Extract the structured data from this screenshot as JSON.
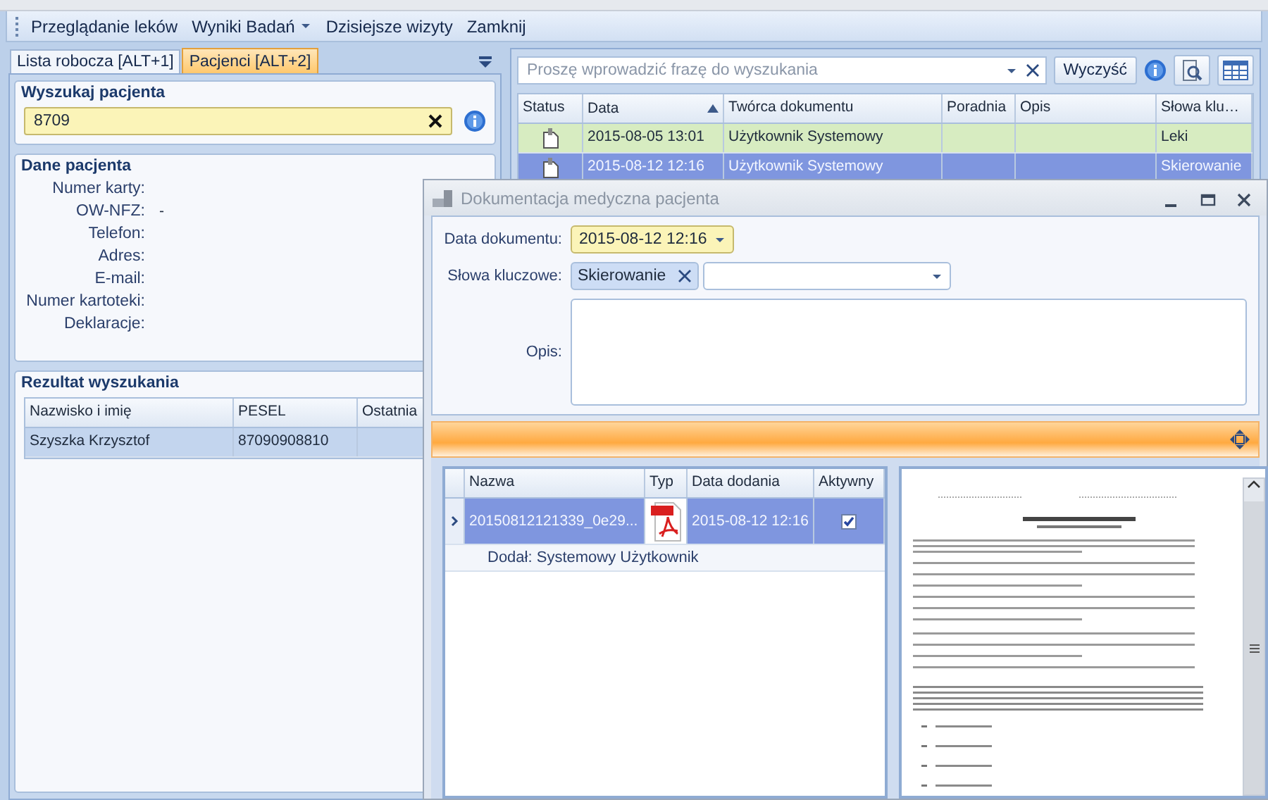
{
  "menu": [
    {
      "label": "Przeglądanie leków",
      "dropdown": false
    },
    {
      "label": "Wyniki Badań",
      "dropdown": true
    },
    {
      "label": "Dzisiejsze wizyty",
      "dropdown": false
    },
    {
      "label": "Zamknij",
      "dropdown": false
    }
  ],
  "left_tabs": [
    {
      "label": "Lista robocza [ALT+1]",
      "selected": false
    },
    {
      "label": "Pacjenci [ALT+2]",
      "selected": true
    }
  ],
  "patient_search": {
    "title": "Wyszukaj pacjenta",
    "value": "8709"
  },
  "patient_data": {
    "title": "Dane pacjenta",
    "fields": [
      {
        "label": "Numer karty:"
      },
      {
        "label": "OW-NFZ:",
        "value": "-"
      },
      {
        "label": "Telefon:"
      },
      {
        "label": "Adres:"
      },
      {
        "label": "E-mail:"
      },
      {
        "label": "Numer kartoteki:"
      },
      {
        "label": "Deklaracje:"
      }
    ]
  },
  "search_results": {
    "title": "Rezultat wyszukania",
    "columns": [
      "Nazwisko i imię",
      "PESEL",
      "Ostatnia"
    ],
    "rows": [
      {
        "cells": [
          "Szyszka Krzysztof",
          "87090908810"
        ],
        "selected": true
      }
    ]
  },
  "documents": {
    "search_placeholder": "Proszę wprowadzić frazę do wyszukania",
    "clear_button": "Wyczyść",
    "columns": [
      {
        "label": "Status",
        "sorted": false
      },
      {
        "label": "Data",
        "sorted": true
      },
      {
        "label": "Twórca dokumentu",
        "sorted": false
      },
      {
        "label": "Poradnia",
        "sorted": false
      },
      {
        "label": "Opis",
        "sorted": false
      },
      {
        "label": "Słowa klu…",
        "sorted": false
      }
    ],
    "rows": [
      {
        "date": "2015-08-05 13:01",
        "author": "Użytkownik Systemowy",
        "keywords": "Leki",
        "highlighted": true,
        "selected": false
      },
      {
        "date": "2015-08-12 12:16",
        "author": "Użytkownik Systemowy",
        "keywords": "Skierowanie",
        "highlighted": false,
        "selected": true
      }
    ]
  },
  "dialog": {
    "title": "Dokumentacja medyczna pacjenta",
    "date_label": "Data dokumentu:",
    "date_value": "2015-08-12 12:16",
    "keywords_label": "Słowa kluczowe:",
    "keyword_tags": [
      "Skierowanie"
    ],
    "description_label": "Opis:",
    "files": {
      "columns": [
        "Nazwa",
        "Typ",
        "Data dodania",
        "Aktywny"
      ],
      "rows": [
        {
          "name": "20150812121339_0e29...",
          "date": "2015-08-12 12:16",
          "active": true,
          "selected": true,
          "added_by": "Dodał: Systemowy Użytkownik"
        }
      ]
    }
  }
}
